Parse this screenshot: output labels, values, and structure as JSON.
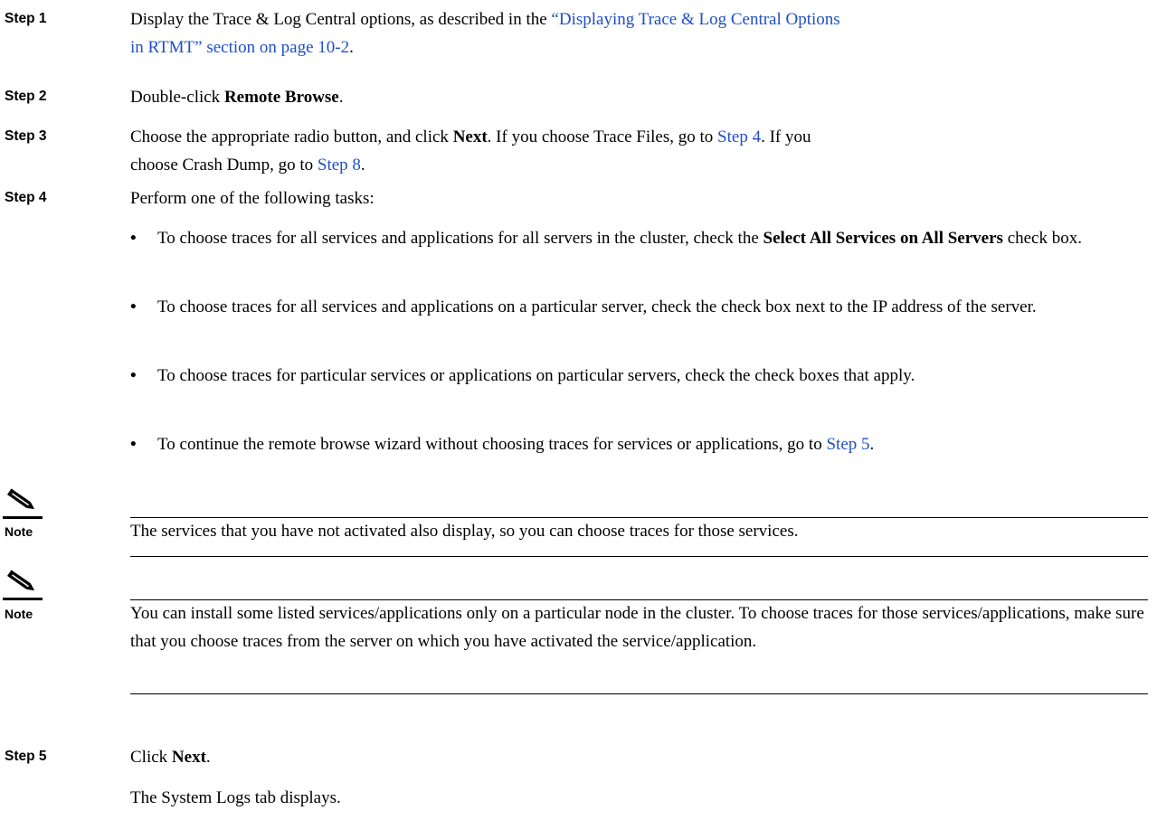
{
  "steps": {
    "s1": {
      "label": "Step 1",
      "pre": "Display the Trace & Log Central options, as described in the ",
      "link1": "“Displaying Trace & Log Central Options",
      "link2": "in RTMT” section on page 10-2",
      "post": "."
    },
    "s2": {
      "label": "Step 2",
      "pre": "Double-click ",
      "bold": "Remote Browse",
      "post": "."
    },
    "s3": {
      "label": "Step 3",
      "pre": "Choose the appropriate radio button, and click ",
      "bold": "Next",
      "mid": ". If you choose Trace Files, go to ",
      "link_a": "Step 4",
      "mid2": ". If you",
      "line2_pre": "choose Crash Dump, go to ",
      "link_b": "Step 8",
      "post": "."
    },
    "s4": {
      "label": "Step 4",
      "text": "Perform one of the following tasks:"
    },
    "s5": {
      "label": "Step 5",
      "pre": "Click ",
      "bold": "Next",
      "post": ".",
      "result": "The System Logs tab displays."
    }
  },
  "bullets": {
    "b1": {
      "pre": "To choose traces for all services and applications for all servers in the cluster, check the ",
      "bold": "Select All Services on All Servers",
      "post": " check box."
    },
    "b2": {
      "text": "To choose traces for all services and applications on a particular server, check the check box next to the IP address of the server."
    },
    "b3": {
      "text": "To choose traces for particular services or applications on particular servers, check the check boxes that apply."
    },
    "b4": {
      "pre": "To continue the remote browse wizard without choosing traces for services or applications, go to ",
      "link": "Step 5",
      "post": "."
    },
    "dot": "•"
  },
  "notes": {
    "label": "Note",
    "n1": "The services that you have not activated also display, so you can choose traces for those services.",
    "n2": "You can install some listed services/applications only on a particular node in the cluster. To choose traces for those services/applications, make sure that you choose traces from the server on which you have activated the service/application."
  },
  "colors": {
    "link": "#1f4fc7",
    "text": "#000000"
  },
  "icons": {
    "note": "pencil-note-icon"
  }
}
